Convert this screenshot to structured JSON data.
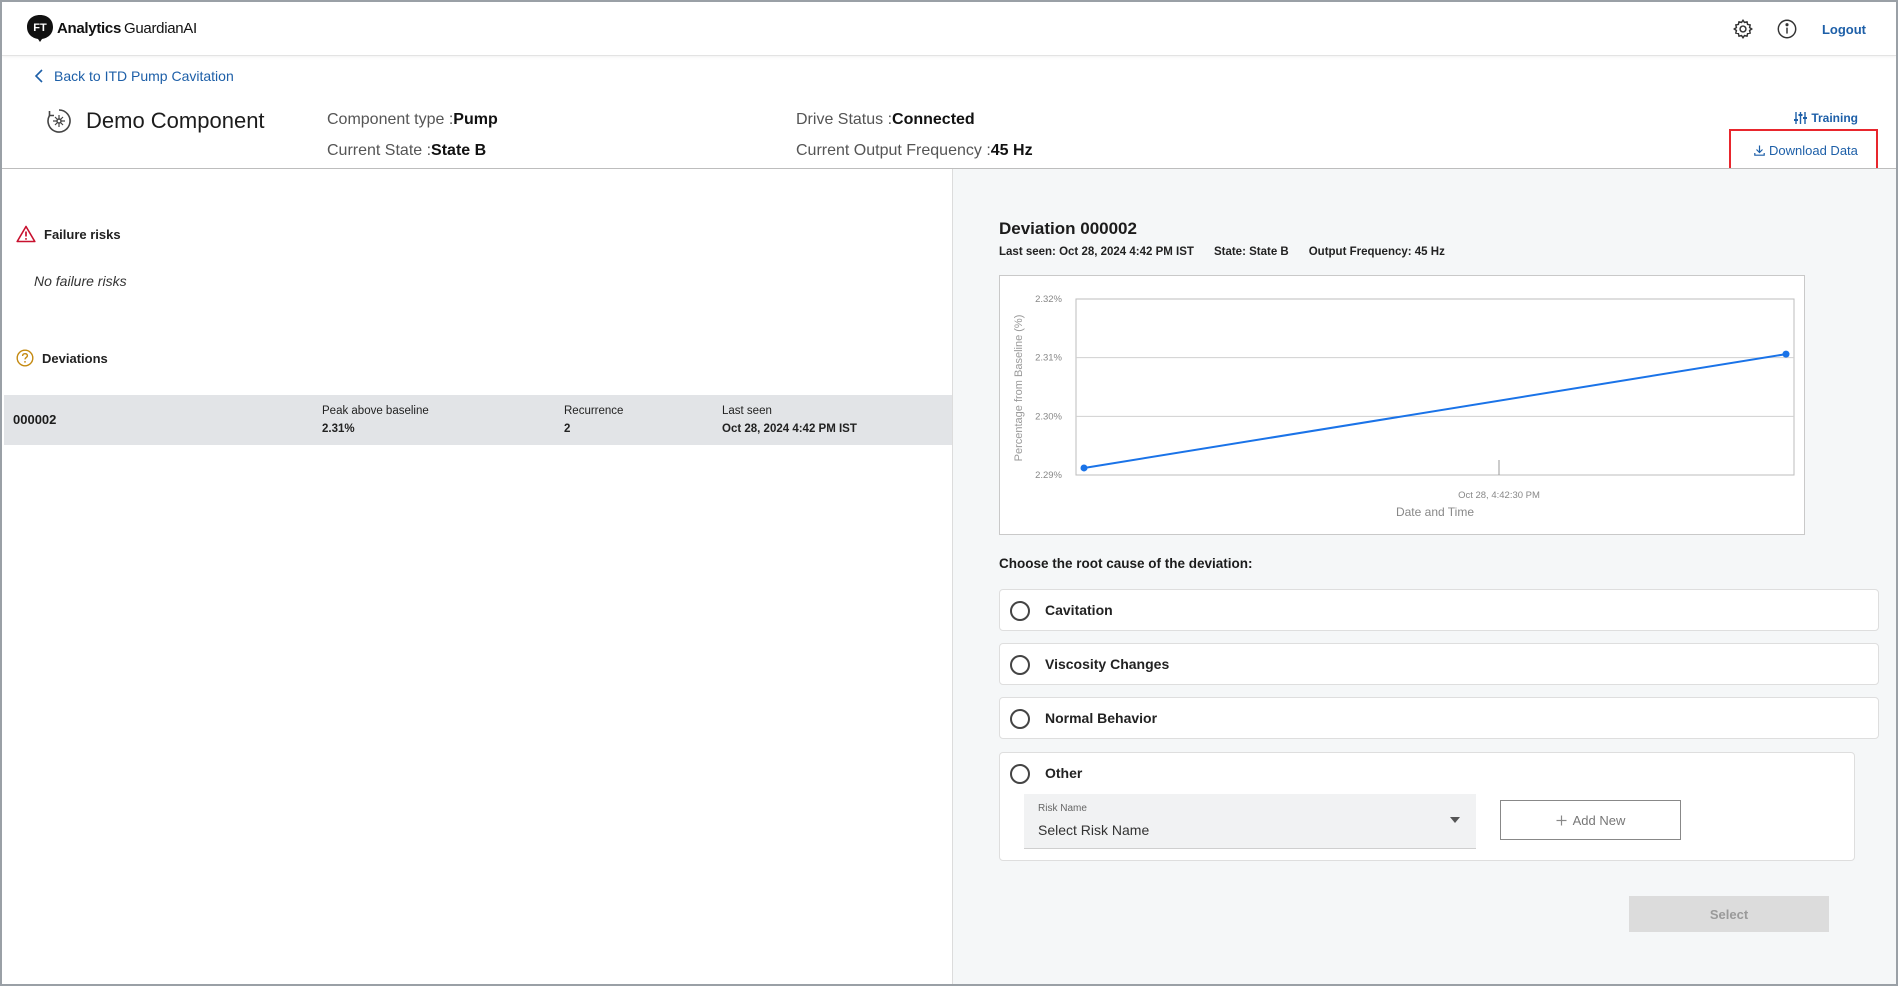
{
  "app": {
    "logo_ft": "FT",
    "logo_analytics": "Analytics",
    "logo_guardian": "GuardianAI",
    "logout_label": "Logout",
    "icons": [
      "gear-icon",
      "info-icon"
    ]
  },
  "header": {
    "back_label": "Back to ITD Pump Cavitation",
    "component_name": "Demo Component",
    "component_type_label": "Component type :",
    "component_type_value": "Pump",
    "current_state_label": "Current State :",
    "current_state_value": "State B",
    "drive_status_label": "Drive Status :",
    "drive_status_value": "Connected",
    "output_freq_label": "Current Output Frequency :",
    "output_freq_value": "45 Hz",
    "training_label": "Training",
    "download_label": "Download Data",
    "highlight_color": "#e8262d"
  },
  "left": {
    "failure_risks_title": "Failure risks",
    "no_failure_risks": "No failure risks",
    "deviations_title": "Deviations",
    "deviations": [
      {
        "id": "000002",
        "peak_label": "Peak above baseline",
        "peak_value": "2.31%",
        "recurrence_label": "Recurrence",
        "recurrence_value": "2",
        "last_seen_label": "Last seen",
        "last_seen_value": "Oct 28, 2024 4:42 PM IST"
      }
    ]
  },
  "right": {
    "deviation_title": "Deviation 000002",
    "last_seen": "Last seen: Oct 28, 2024 4:42 PM IST",
    "state": "State: State B",
    "output_frequency": "Output Frequency: 45 Hz",
    "root_cause_question": "Choose the root cause of the deviation:",
    "options": [
      "Cavitation",
      "Viscosity Changes",
      "Normal Behavior",
      "Other"
    ],
    "risk_name_label": "Risk Name",
    "risk_name_placeholder": "Select Risk Name",
    "add_new_label": "Add New",
    "select_label": "Select"
  },
  "chart_data": {
    "type": "line",
    "title": "",
    "xlabel": "Date and Time",
    "ylabel": "Percentage from Baseline (%)",
    "y_ticks": [
      "2.32%",
      "2.31%",
      "2.30%",
      "2.29%"
    ],
    "ylim": [
      2.29,
      2.32
    ],
    "x_tick_label": "Oct 28, 4:42:30 PM",
    "series": [
      {
        "values": [
          2.2912,
          2.3106
        ],
        "color": "#1a73e8"
      }
    ],
    "grid": true
  }
}
